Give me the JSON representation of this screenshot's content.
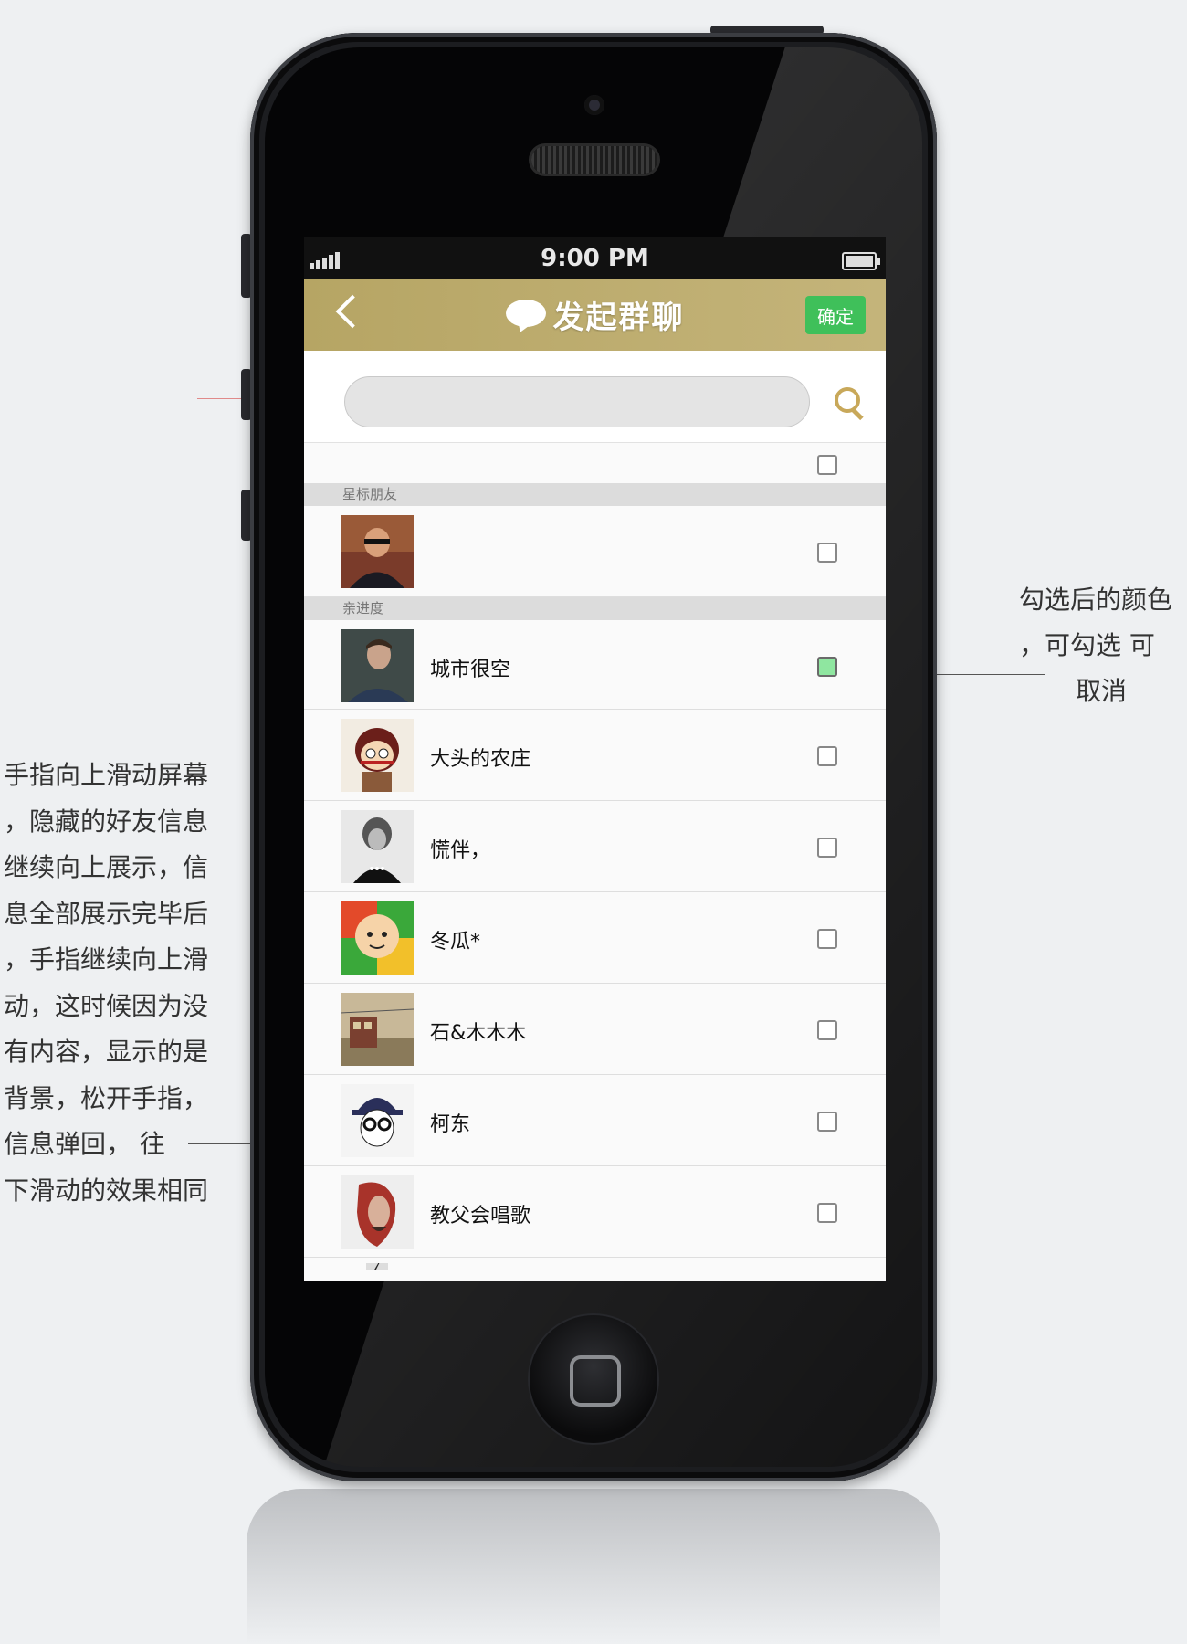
{
  "annotations": {
    "left_text": "手指向上滑动屏幕\n，隐藏的好友信息\n继续向上展示，信\n息全部展示完毕后\n，手指继续向上滑\n动，这时候因为没\n有内容，显示的是\n背景，松开手指，\n 信息弹回，     往\n下滑动的效果相同",
    "right_line1": "勾选后的颜色",
    "right_line2": "，可勾选    可",
    "right_line3": "取消"
  },
  "status_bar": {
    "time": "9:00 PM",
    "signal_icon": "signal-bars-icon",
    "battery_icon": "battery-icon"
  },
  "nav": {
    "title": "发起群聊",
    "confirm_label": "确定",
    "back_icon": "chevron-left-icon",
    "chat_icon": "chat-bubble-icon"
  },
  "search": {
    "placeholder": "",
    "icon": "search-icon"
  },
  "sections": [
    {
      "header": "星标朋友"
    },
    {
      "header": "亲进度"
    }
  ],
  "contacts": [
    {
      "name": "",
      "checked": false
    },
    {
      "name": "城市很空",
      "checked": true
    },
    {
      "name": "大头的农庄",
      "checked": false
    },
    {
      "name": "慌伴，",
      "checked": false
    },
    {
      "name": "冬瓜*",
      "checked": false
    },
    {
      "name": "石&木木木",
      "checked": false
    },
    {
      "name": "柯东",
      "checked": false
    },
    {
      "name": "教父会唱歌",
      "checked": false
    }
  ],
  "colors": {
    "nav_bg": "#b6a564",
    "confirm_bg": "#3fc05a",
    "checked_fill": "#8fe6a0",
    "search_icon": "#c8a85a"
  }
}
